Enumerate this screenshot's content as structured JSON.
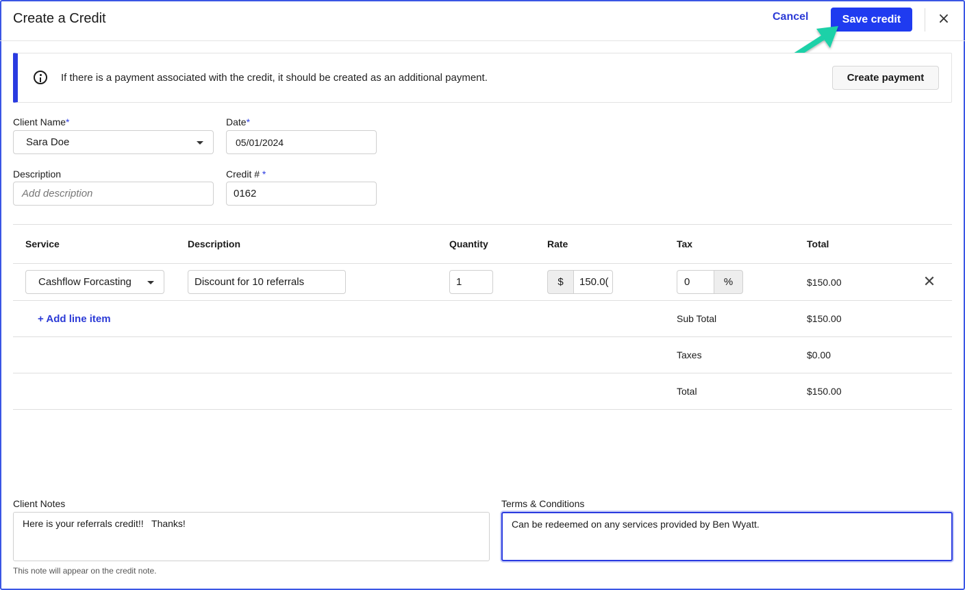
{
  "header": {
    "title": "Create a Credit",
    "cancel_label": "Cancel",
    "save_label": "Save credit",
    "close_glyph": "×"
  },
  "banner": {
    "text": "If there is a payment associated with the credit, it should be created as an additional payment.",
    "button_label": "Create payment",
    "icon": "info-icon"
  },
  "form": {
    "client_name": {
      "label": "Client Name",
      "required_mark": "*",
      "value": "Sara Doe"
    },
    "date": {
      "label": "Date",
      "required_mark": "*",
      "value": "05/01/2024"
    },
    "description": {
      "label": "Description",
      "placeholder": "Add description",
      "value": ""
    },
    "credit_number": {
      "label": "Credit # ",
      "required_mark": "*",
      "value": "0162"
    }
  },
  "table": {
    "columns": [
      "Service",
      "Description",
      "Quantity",
      "Rate",
      "Tax",
      "Total"
    ],
    "rows": [
      {
        "service": "Cashflow Forcasting",
        "description": "Discount for 10 referrals",
        "quantity": "1",
        "rate_prefix": "$",
        "rate": "150.0(",
        "tax": "0",
        "tax_suffix": "%",
        "total": "$150.00"
      }
    ],
    "add_line_label": "+ Add line item",
    "delete_glyph": "✕",
    "summary": {
      "subtotal_label": "Sub Total",
      "subtotal_value": "$150.00",
      "taxes_label": "Taxes",
      "taxes_value": "$0.00",
      "total_label": "Total",
      "total_value": "$150.00"
    }
  },
  "notes": {
    "client_notes_label": "Client Notes",
    "client_notes_value": "Here is your referrals credit!!   Thanks!",
    "client_notes_hint": "This note will appear on the credit note.",
    "terms_label": "Terms & Conditions",
    "terms_value": "Can be redeemed on any services provided by Ben Wyatt."
  },
  "colors": {
    "accent": "#1f3bf0",
    "link": "#2b3ad6",
    "arrow": "#1fd1a8"
  }
}
